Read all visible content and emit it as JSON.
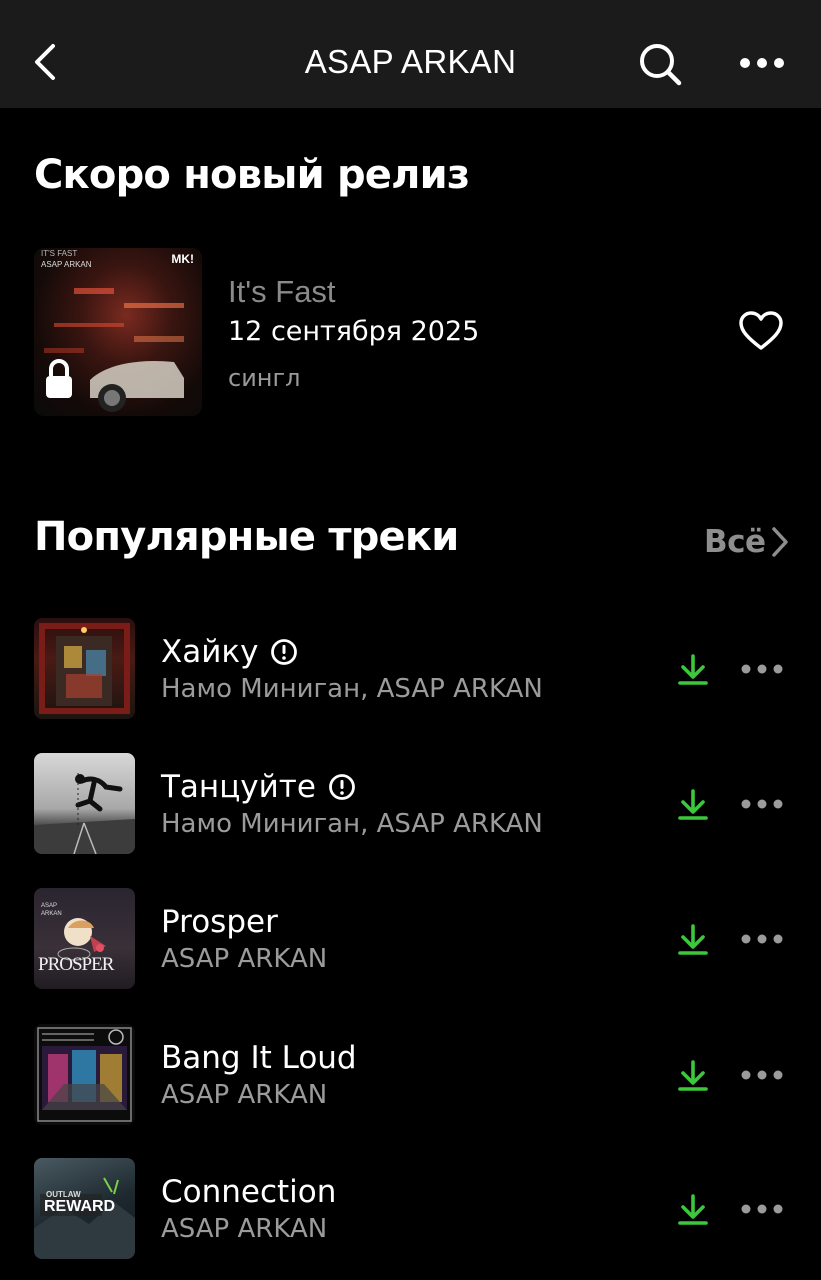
{
  "header": {
    "title": "ASAP ARKAN",
    "back_icon": "chevron-left-icon",
    "search_icon": "search-icon",
    "more_icon": "more-horizontal-icon"
  },
  "upcoming": {
    "heading": "Скоро новый релиз",
    "release": {
      "title": "It's Fast",
      "date": "12 сентября 2025",
      "type": "сингл",
      "cover_text_line1": "IT'S FAST",
      "cover_text_line2": "ASAP ARKAN",
      "cover_logo": "MK!",
      "locked": true
    }
  },
  "popular": {
    "heading": "Популярные треки",
    "all_label": "Всё",
    "tracks": [
      {
        "title": "Хайку",
        "artist": "Намо Миниган, ASAP ARKAN",
        "explicit": true
      },
      {
        "title": "Танцуйте",
        "artist": "Намо Миниган, ASAP ARKAN",
        "explicit": true
      },
      {
        "title": "Prosper",
        "artist": "ASAP ARKAN",
        "explicit": false,
        "cover_text": "PROSPER",
        "cover_small": "ASAP ARKAN"
      },
      {
        "title": "Bang It Loud",
        "artist": "ASAP ARKAN",
        "explicit": false
      },
      {
        "title": "Connection",
        "artist": "ASAP ARKAN",
        "explicit": false,
        "cover_text": "REWARD",
        "cover_small": "OUTLAW"
      }
    ]
  },
  "colors": {
    "background": "#000000",
    "header_bg": "#1b1b1b",
    "download_green": "#3cc73c",
    "secondary_text": "#9b9b9b"
  }
}
